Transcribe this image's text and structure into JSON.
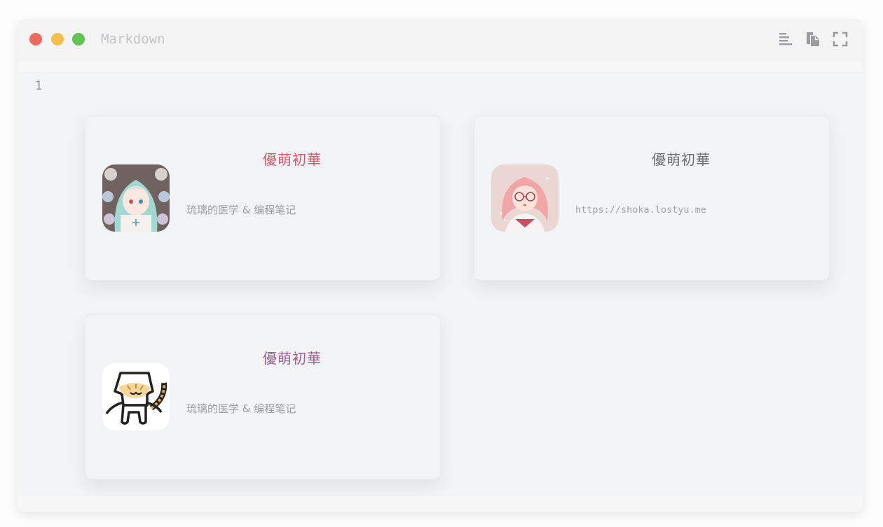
{
  "window": {
    "title": "Markdown",
    "icons": [
      "align-left-icon",
      "copy-icon",
      "fullscreen-icon"
    ]
  },
  "editor": {
    "line_number": "1"
  },
  "cards": [
    {
      "title": "優萌初華",
      "description": "琉璃的医学 & 编程笔记",
      "title_color": "#d9596b",
      "avatar": "anime-girl-teal-hair-avatar"
    },
    {
      "title": "優萌初華",
      "description": "https://shoka.lostyu.me",
      "title_color": "#6c6e72",
      "avatar": "anime-girl-pink-hair-glasses-avatar"
    },
    {
      "title": "優萌初華",
      "description": "琉璃的医学 & 编程笔记",
      "title_color": "#9a5d8e",
      "avatar": "cat-in-box-avatar"
    }
  ]
}
